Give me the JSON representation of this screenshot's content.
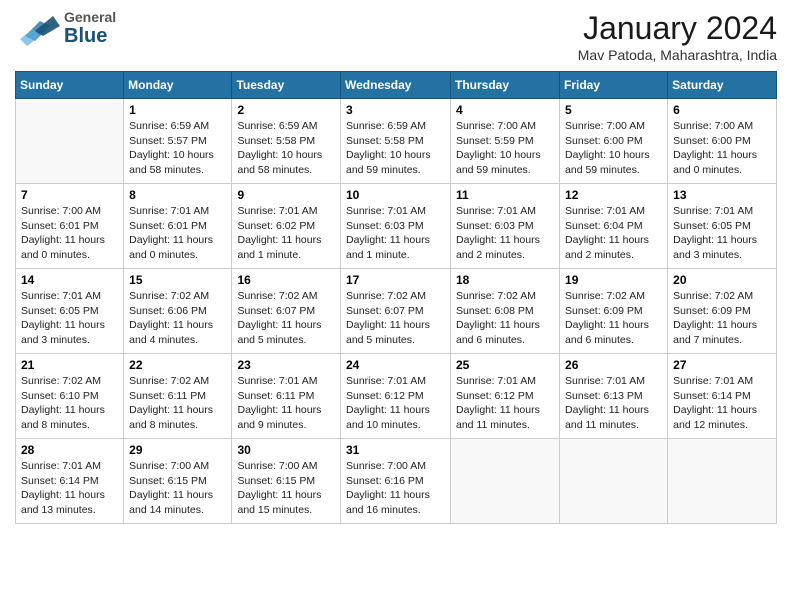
{
  "header": {
    "logo_general": "General",
    "logo_blue": "Blue",
    "month_title": "January 2024",
    "subtitle": "Mav Patoda, Maharashtra, India"
  },
  "days_of_week": [
    "Sunday",
    "Monday",
    "Tuesday",
    "Wednesday",
    "Thursday",
    "Friday",
    "Saturday"
  ],
  "weeks": [
    [
      {
        "num": "",
        "info": ""
      },
      {
        "num": "1",
        "info": "Sunrise: 6:59 AM\nSunset: 5:57 PM\nDaylight: 10 hours\nand 58 minutes."
      },
      {
        "num": "2",
        "info": "Sunrise: 6:59 AM\nSunset: 5:58 PM\nDaylight: 10 hours\nand 58 minutes."
      },
      {
        "num": "3",
        "info": "Sunrise: 6:59 AM\nSunset: 5:58 PM\nDaylight: 10 hours\nand 59 minutes."
      },
      {
        "num": "4",
        "info": "Sunrise: 7:00 AM\nSunset: 5:59 PM\nDaylight: 10 hours\nand 59 minutes."
      },
      {
        "num": "5",
        "info": "Sunrise: 7:00 AM\nSunset: 6:00 PM\nDaylight: 10 hours\nand 59 minutes."
      },
      {
        "num": "6",
        "info": "Sunrise: 7:00 AM\nSunset: 6:00 PM\nDaylight: 11 hours\nand 0 minutes."
      }
    ],
    [
      {
        "num": "7",
        "info": "Sunrise: 7:00 AM\nSunset: 6:01 PM\nDaylight: 11 hours\nand 0 minutes."
      },
      {
        "num": "8",
        "info": "Sunrise: 7:01 AM\nSunset: 6:01 PM\nDaylight: 11 hours\nand 0 minutes."
      },
      {
        "num": "9",
        "info": "Sunrise: 7:01 AM\nSunset: 6:02 PM\nDaylight: 11 hours\nand 1 minute."
      },
      {
        "num": "10",
        "info": "Sunrise: 7:01 AM\nSunset: 6:03 PM\nDaylight: 11 hours\nand 1 minute."
      },
      {
        "num": "11",
        "info": "Sunrise: 7:01 AM\nSunset: 6:03 PM\nDaylight: 11 hours\nand 2 minutes."
      },
      {
        "num": "12",
        "info": "Sunrise: 7:01 AM\nSunset: 6:04 PM\nDaylight: 11 hours\nand 2 minutes."
      },
      {
        "num": "13",
        "info": "Sunrise: 7:01 AM\nSunset: 6:05 PM\nDaylight: 11 hours\nand 3 minutes."
      }
    ],
    [
      {
        "num": "14",
        "info": "Sunrise: 7:01 AM\nSunset: 6:05 PM\nDaylight: 11 hours\nand 3 minutes."
      },
      {
        "num": "15",
        "info": "Sunrise: 7:02 AM\nSunset: 6:06 PM\nDaylight: 11 hours\nand 4 minutes."
      },
      {
        "num": "16",
        "info": "Sunrise: 7:02 AM\nSunset: 6:07 PM\nDaylight: 11 hours\nand 5 minutes."
      },
      {
        "num": "17",
        "info": "Sunrise: 7:02 AM\nSunset: 6:07 PM\nDaylight: 11 hours\nand 5 minutes."
      },
      {
        "num": "18",
        "info": "Sunrise: 7:02 AM\nSunset: 6:08 PM\nDaylight: 11 hours\nand 6 minutes."
      },
      {
        "num": "19",
        "info": "Sunrise: 7:02 AM\nSunset: 6:09 PM\nDaylight: 11 hours\nand 6 minutes."
      },
      {
        "num": "20",
        "info": "Sunrise: 7:02 AM\nSunset: 6:09 PM\nDaylight: 11 hours\nand 7 minutes."
      }
    ],
    [
      {
        "num": "21",
        "info": "Sunrise: 7:02 AM\nSunset: 6:10 PM\nDaylight: 11 hours\nand 8 minutes."
      },
      {
        "num": "22",
        "info": "Sunrise: 7:02 AM\nSunset: 6:11 PM\nDaylight: 11 hours\nand 8 minutes."
      },
      {
        "num": "23",
        "info": "Sunrise: 7:01 AM\nSunset: 6:11 PM\nDaylight: 11 hours\nand 9 minutes."
      },
      {
        "num": "24",
        "info": "Sunrise: 7:01 AM\nSunset: 6:12 PM\nDaylight: 11 hours\nand 10 minutes."
      },
      {
        "num": "25",
        "info": "Sunrise: 7:01 AM\nSunset: 6:12 PM\nDaylight: 11 hours\nand 11 minutes."
      },
      {
        "num": "26",
        "info": "Sunrise: 7:01 AM\nSunset: 6:13 PM\nDaylight: 11 hours\nand 11 minutes."
      },
      {
        "num": "27",
        "info": "Sunrise: 7:01 AM\nSunset: 6:14 PM\nDaylight: 11 hours\nand 12 minutes."
      }
    ],
    [
      {
        "num": "28",
        "info": "Sunrise: 7:01 AM\nSunset: 6:14 PM\nDaylight: 11 hours\nand 13 minutes."
      },
      {
        "num": "29",
        "info": "Sunrise: 7:00 AM\nSunset: 6:15 PM\nDaylight: 11 hours\nand 14 minutes."
      },
      {
        "num": "30",
        "info": "Sunrise: 7:00 AM\nSunset: 6:15 PM\nDaylight: 11 hours\nand 15 minutes."
      },
      {
        "num": "31",
        "info": "Sunrise: 7:00 AM\nSunset: 6:16 PM\nDaylight: 11 hours\nand 16 minutes."
      },
      {
        "num": "",
        "info": ""
      },
      {
        "num": "",
        "info": ""
      },
      {
        "num": "",
        "info": ""
      }
    ]
  ]
}
